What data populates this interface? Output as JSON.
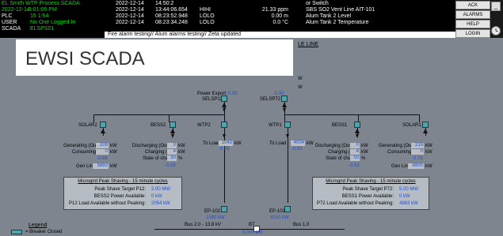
{
  "status": {
    "plant_name": "EL Smith WTP Process SCADA",
    "date": "2022-12-14",
    "time": "3:01:05 PM",
    "plc_label": "PLC",
    "plc_value": "15  1:54",
    "user_label": "USER",
    "user_value": "No One Logged In",
    "scada_label": "SCADA",
    "scada_value": "ELSPS01"
  },
  "alarms": [
    {
      "date": "2022-12-14",
      "time": "14:50:2",
      "type": "",
      "value": "",
      "unit": "",
      "desc": "or Switch"
    },
    {
      "date": "2022-12-14",
      "time": "13:44:06.654",
      "type": "HIHI",
      "value": "21.33",
      "unit": "ppm",
      "desc": "SBS SO2 Vent Line AIT-101"
    },
    {
      "date": "2022-12-14",
      "time": "08:23:52.948",
      "type": "LOLO",
      "value": "0.00",
      "unit": "m",
      "desc": "Alum Tank 2 Level"
    },
    {
      "date": "2022-12-14",
      "time": "08:23:34.248",
      "type": "LOLO",
      "value": "0.0",
      "unit": "°C",
      "desc": "Alum Tank 2 Temperature"
    }
  ],
  "ticker": "Fire alarm testing// Alum alarms testing// Zeta updated",
  "buttons": {
    "ack": "ACK",
    "alarms": "ALARMS",
    "help": "HELP",
    "login": "LOGIN",
    "minimize": "_"
  },
  "overlay_title": "EWSI SCADA",
  "diagram": {
    "header_fragment": "LE LINE",
    "frag_w1": "W",
    "frag_w2": "W",
    "selsp12": {
      "label": "SELSP12",
      "pre": "Power Export",
      "value": "-0.93"
    },
    "selsp72": {
      "label": "SELSP72",
      "value": "-0.90"
    },
    "sources": {
      "solar2": "SOLAR2",
      "bess2": "BESS2",
      "wtp2": "WTP2",
      "wtp1": "WTP1",
      "bess1": "BESS1",
      "solar1": "SOLAR1"
    },
    "left_gen": {
      "gen_out_label": "Generating (Out)",
      "gen_out_value": "209",
      "gen_out_unit": "kW",
      "cons_label": "Consuming (In)",
      "cons_value": "0",
      "cons_unit": "kW",
      "neg_value": "-0.69",
      "limit_label": "Gen Limit",
      "limit_value": "5893",
      "limit_unit": "kW"
    },
    "left_bess": {
      "dis_label": "Discharging (Out)",
      "dis_value": "0",
      "dis_unit": "kW",
      "chg_label": "Charging (In)",
      "chg_value": "4",
      "chg_unit": "kW",
      "soc_label": "State of charge",
      "soc_value": "50",
      "soc_unit": "%",
      "neg_value": "-0.93"
    },
    "wtp2_load": {
      "label": "To Load",
      "value": "1043",
      "unit": "kW",
      "neg": "-0.89"
    },
    "wtp1_load": {
      "label": "To Load",
      "value": "4004",
      "unit": "kW",
      "neg": "-0.91"
    },
    "right_bess": {
      "dis_label": "Discharging (Out)",
      "dis_value": "0",
      "dis_unit": "kW",
      "chg_label": "Charging (In)",
      "chg_value": "4",
      "chg_unit": "kW",
      "soc_label": "State of charge",
      "soc_value": "50",
      "soc_unit": "%",
      "neg_value": "-0.92"
    },
    "right_gen": {
      "gen_out_label": "Generating (Out)",
      "gen_out_value": "219",
      "gen_out_unit": "kW",
      "cons_label": "Consuming (In)",
      "cons_value": "0",
      "cons_unit": "kW",
      "neg_value": "-0.75",
      "limit_label": "Gen Limit",
      "limit_value": "6800",
      "limit_unit": "kW"
    },
    "peak_left": {
      "title": "Microgrid Peak Shaving - 15 minute cycles",
      "target_label": "Peak Shave Target P12:",
      "target_value": "2.00 MW",
      "bess_label": "BESS2 Power Available:",
      "bess_value": "0 kW",
      "load_label": "P12 Load Available without Peaking:",
      "load_value": "2054 kW"
    },
    "peak_right": {
      "title": "Microgrid Peak Shaving - 15 minute cycles",
      "target_label": "Peak Shave Target P72:",
      "target_value": "5.00 MW",
      "bess_label": "BESS1 Power Available:",
      "bess_value": "0 kW",
      "load_label": "P72 Load Available without Peaking:",
      "load_value": "4883 kW"
    },
    "ep102": {
      "label": "EP-102",
      "value": "1040 kW"
    },
    "ep101": {
      "label": "EP-101",
      "value": "4010 kW"
    },
    "bus2": "Bus 2.0 - 13.8 kV",
    "bt": "BT",
    "bus1": "Bus 1.0",
    "bus_value": "0.000 kW",
    "legend_title": "Legend",
    "legend_item": "= Breaker Closed"
  },
  "colors": {
    "node": "#4aa7b0",
    "value_blue": "#1e4fd0",
    "status_green": "#00e000",
    "alarm_red": "#ff3333"
  }
}
